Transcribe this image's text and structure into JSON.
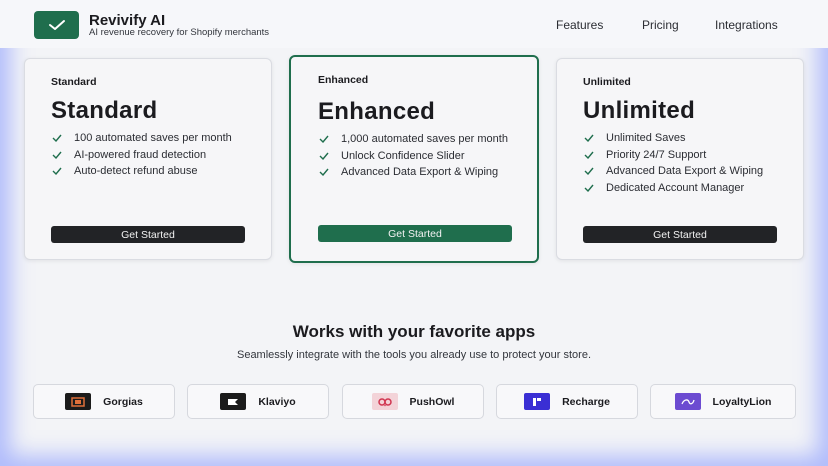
{
  "header": {
    "brand_name": "Revivify AI",
    "tagline": "AI revenue recovery for Shopify merchants",
    "nav": [
      {
        "label": "Features"
      },
      {
        "label": "Pricing"
      },
      {
        "label": "Integrations"
      }
    ]
  },
  "plans": [
    {
      "tier_small": "Standard",
      "tier_big": "Standard",
      "features": [
        "100 automated saves per month",
        "AI-powered fraud detection",
        "Auto-detect refund abuse"
      ],
      "cta": "Get Started"
    },
    {
      "tier_small": "Enhanced",
      "tier_big": "Enhanced",
      "features": [
        "1,000 automated saves per month",
        "Unlock Confidence Slider",
        "Advanced Data Export & Wiping"
      ],
      "cta": "Get Started"
    },
    {
      "tier_small": "Unlimited",
      "tier_big": "Unlimited",
      "features": [
        "Unlimited Saves",
        "Priority 24/7 Support",
        "Advanced Data Export & Wiping",
        "Dedicated Account Manager"
      ],
      "cta": "Get Started"
    }
  ],
  "integrations": {
    "title": "Works with your favorite apps",
    "subtitle": "Seamlessly integrate with the tools you already use to protect your store.",
    "apps": [
      {
        "name": "Gorgias",
        "icon": "gorgias-logo-icon"
      },
      {
        "name": "Klaviyo",
        "icon": "klaviyo-logo-icon"
      },
      {
        "name": "PushOwl",
        "icon": "pushowl-logo-icon"
      },
      {
        "name": "Recharge",
        "icon": "recharge-logo-icon"
      },
      {
        "name": "LoyaltyLion",
        "icon": "loyaltylion-logo-icon"
      }
    ]
  },
  "colors": {
    "brand_green": "#1f6e4d",
    "dark_button": "#222326",
    "glow": "#788cff"
  }
}
